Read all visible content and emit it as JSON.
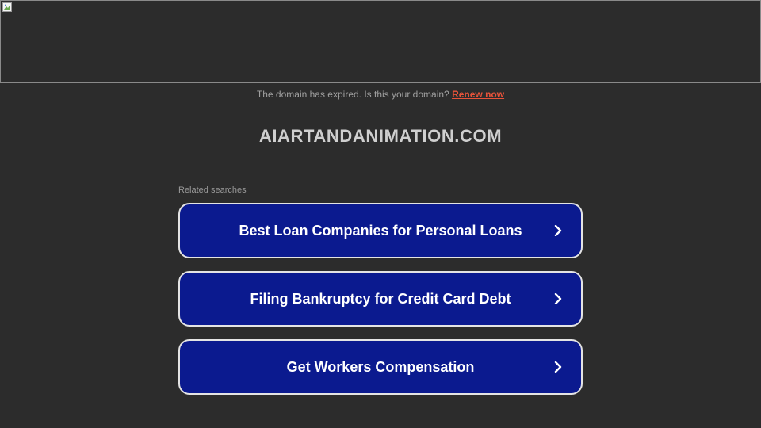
{
  "notice": {
    "message": "The domain has expired. Is this your domain?",
    "renew_link": "Renew now"
  },
  "domain": {
    "name": "AIARTANDANIMATION.COM"
  },
  "related": {
    "label": "Related searches",
    "items": [
      {
        "label": "Best Loan Companies for Personal Loans"
      },
      {
        "label": "Filing Bankruptcy for Credit Card Debt"
      },
      {
        "label": "Get Workers Compensation"
      }
    ]
  },
  "colors": {
    "background": "#2c2c2c",
    "button_bg": "#0b1a8f",
    "button_border": "#e4e4e4",
    "link": "#e8533a"
  }
}
